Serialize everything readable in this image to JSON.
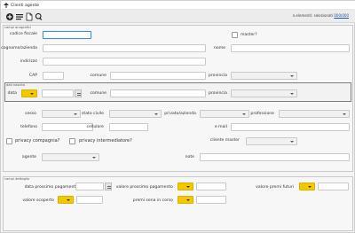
{
  "window": {
    "title": "Clienti agente"
  },
  "toolbar": {
    "buttons": [
      {
        "icon": "add-icon"
      },
      {
        "icon": "list-icon"
      },
      {
        "icon": "document-icon"
      },
      {
        "icon": "search-icon"
      }
    ],
    "status_text": "n.elementi: selezionati",
    "status_count": "000/000"
  },
  "anagrafica": {
    "legend": "campi anagrafici",
    "codice_fiscale": {
      "label": "codice fiscale",
      "value": ""
    },
    "master": {
      "label": "master?",
      "checked": false
    },
    "cognome_azienda": {
      "label": "cognome/azienda",
      "value": ""
    },
    "nome": {
      "label": "nome",
      "value": ""
    },
    "indirizzo": {
      "label": "indirizzo",
      "value": ""
    },
    "cap": {
      "label": "CAP",
      "value": ""
    },
    "comune": {
      "label": "comune",
      "value": ""
    },
    "provincia": {
      "label": "provincia",
      "value": ""
    }
  },
  "nascita": {
    "legend": "dati nascita",
    "data": {
      "label": "data",
      "value": ""
    },
    "comune": {
      "label": "comune",
      "value": ""
    },
    "provincia": {
      "label": "provincia",
      "value": ""
    }
  },
  "altri": {
    "sesso": {
      "label": "sesso",
      "value": ""
    },
    "stato_civile": {
      "label": "stato civile",
      "value": ""
    },
    "privato_azienda": {
      "label": "privato/azienda",
      "value": ""
    },
    "professione": {
      "label": "professione",
      "value": ""
    },
    "telefono": {
      "label": "telefono",
      "value": ""
    },
    "cellulare": {
      "label": "cellulare",
      "value": ""
    },
    "email": {
      "label": "e mail",
      "value": ""
    },
    "privacy_compagnia": {
      "label": "privacy compagnia?",
      "checked": false
    },
    "privacy_intermediatore": {
      "label": "privacy intermediatore?",
      "checked": false
    },
    "cliente_master": {
      "label": "cliente master",
      "value": ""
    },
    "agente": {
      "label": "agente",
      "value": ""
    },
    "note": {
      "label": "note",
      "value": ""
    }
  },
  "dettaglio": {
    "legend": "campi dettaglio",
    "data_prossimo_pagamento": {
      "label": "data prossimo pagamento",
      "value": ""
    },
    "valore_prossimo_pagamento": {
      "label": "valore prossimo pagamento",
      "value": ""
    },
    "valore_premi_futuri": {
      "label": "valore premi futuri",
      "value": ""
    },
    "valore_scoperto": {
      "label": "valore scoperto",
      "value": ""
    },
    "premi_sena_in_corso": {
      "label": "premi sena in corso",
      "value": ""
    }
  },
  "colors": {
    "yellow": "#f2c800",
    "focus": "#3a8fd6"
  }
}
